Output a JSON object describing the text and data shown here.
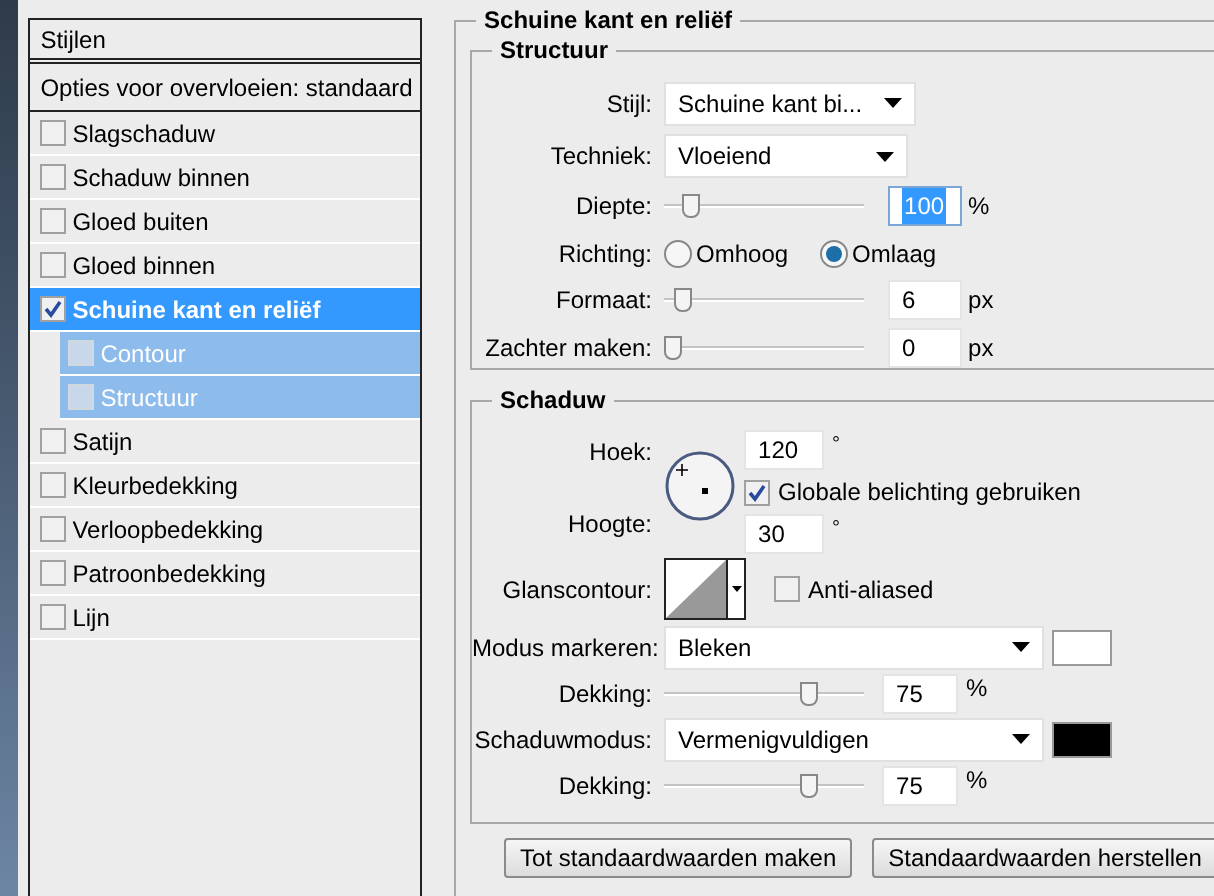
{
  "sidebar": {
    "header": "Stijlen",
    "blending": "Opties voor overvloeien: standaard",
    "items": [
      {
        "label": "Slagschaduw",
        "checked": false,
        "selected": false
      },
      {
        "label": "Schaduw binnen",
        "checked": false,
        "selected": false
      },
      {
        "label": "Gloed buiten",
        "checked": false,
        "selected": false
      },
      {
        "label": "Gloed binnen",
        "checked": false,
        "selected": false
      },
      {
        "label": "Schuine kant en reliëf",
        "checked": true,
        "selected": true,
        "children": [
          {
            "label": "Contour",
            "checked": false,
            "selected": false
          },
          {
            "label": "Structuur",
            "checked": false,
            "selected": false
          }
        ]
      },
      {
        "label": "Satijn",
        "checked": false,
        "selected": false
      },
      {
        "label": "Kleurbedekking",
        "checked": false,
        "selected": false
      },
      {
        "label": "Verloopbedekking",
        "checked": false,
        "selected": false
      },
      {
        "label": "Patroonbedekking",
        "checked": false,
        "selected": false
      },
      {
        "label": "Lijn",
        "checked": false,
        "selected": false
      }
    ]
  },
  "panel": {
    "title": "Schuine kant en reliëf",
    "structure": {
      "title": "Structuur",
      "rows": [
        {
          "kind": "select",
          "label": "Stijl:",
          "value": "Schuine kant bi..."
        },
        {
          "kind": "select",
          "label": "Techniek:",
          "value": "Vloeiend"
        },
        {
          "kind": "slider",
          "label": "Diepte:",
          "level": 0.1,
          "value": "100",
          "unit": "%",
          "focused": true
        },
        {
          "kind": "radio",
          "label": "Richting:",
          "options": [
            {
              "label": "Omhoog",
              "selected": false
            },
            {
              "label": "Omlaag",
              "selected": true
            }
          ]
        },
        {
          "kind": "slider",
          "label": "Formaat:",
          "level": 0.06,
          "value": "6",
          "unit": "px",
          "focused": false
        },
        {
          "kind": "slider",
          "label": "Zachter maken:",
          "level": 0,
          "value": "0",
          "unit": "px",
          "focused": false
        }
      ]
    },
    "shading": {
      "title": "Schaduw",
      "angle_label": "Hoek:",
      "angle": "120",
      "angle_unit": "°",
      "global_light": {
        "label": "Globale belichting gebruiken",
        "checked": true
      },
      "altitude_label": "Hoogte:",
      "altitude": "30",
      "altitude_unit": "°",
      "gloss_label": "Glanscontour:",
      "anti_aliased": {
        "label": "Anti-aliased",
        "checked": false
      },
      "modes": [
        {
          "label": "Modus markeren:",
          "value": "Bleken",
          "color": "#ffffff",
          "opacity_label": "Dekking:",
          "level": 0.75,
          "opacity": "75",
          "unit": "%"
        },
        {
          "label": "Schaduwmodus:",
          "value": "Vermenigvuldigen",
          "color": "#000000",
          "opacity_label": "Dekking:",
          "level": 0.75,
          "opacity": "75",
          "unit": "%"
        }
      ]
    }
  },
  "buttons": [
    "Tot standaardwaarden maken",
    "Standaardwaarden herstellen"
  ]
}
